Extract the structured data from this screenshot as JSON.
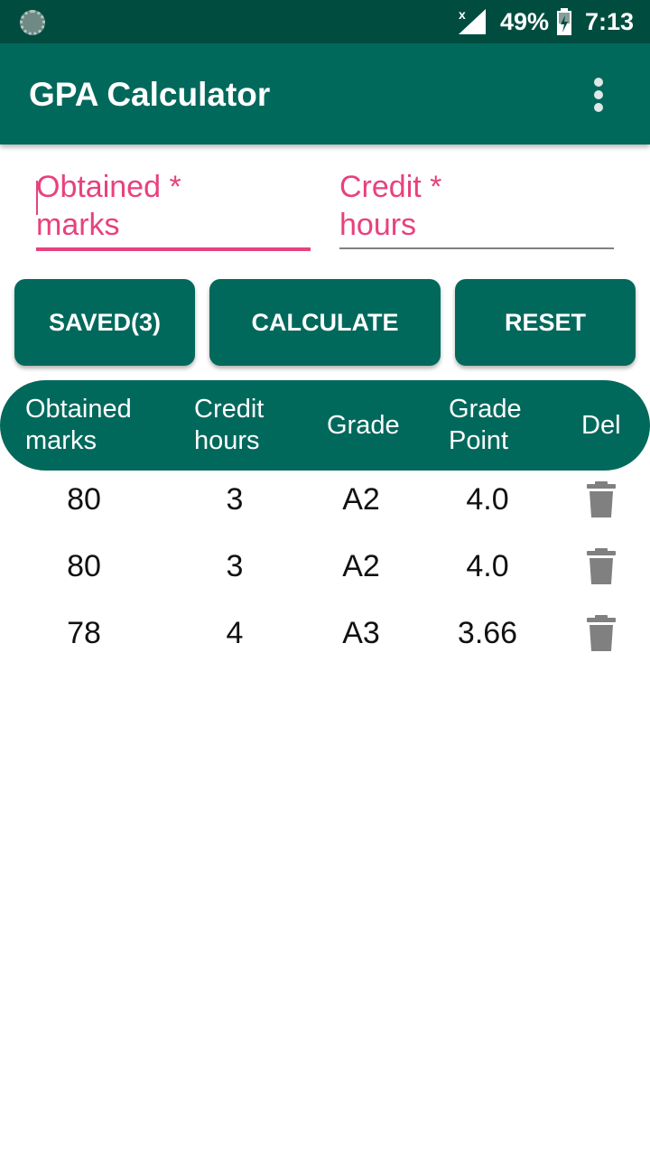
{
  "status_bar": {
    "battery": "49%",
    "time": "7:13",
    "icons": [
      "sync-icon",
      "signal-x-icon",
      "battery-charging-icon"
    ]
  },
  "app_bar": {
    "title": "GPA Calculator",
    "menu_icon": "overflow-menu-icon"
  },
  "form": {
    "obtained_label": "Obtained *\nmarks",
    "credit_label": "Credit *\nhours",
    "accent_color": "#e8417e"
  },
  "buttons": {
    "saved": "SAVED(3)",
    "calculate": "CALCULATE",
    "reset": "RESET"
  },
  "table": {
    "headers": [
      "Obtained\nmarks",
      "Credit\nhours",
      "Grade",
      "Grade\nPoint",
      "Del"
    ],
    "rows": [
      {
        "marks": "80",
        "credit": "3",
        "grade": "A2",
        "point": "4.0"
      },
      {
        "marks": "80",
        "credit": "3",
        "grade": "A2",
        "point": "4.0"
      },
      {
        "marks": "78",
        "credit": "4",
        "grade": "A3",
        "point": "3.66"
      }
    ],
    "delete_icon": "trash-icon"
  },
  "theme": {
    "primary": "#00695c",
    "status_bar": "#004d40"
  }
}
